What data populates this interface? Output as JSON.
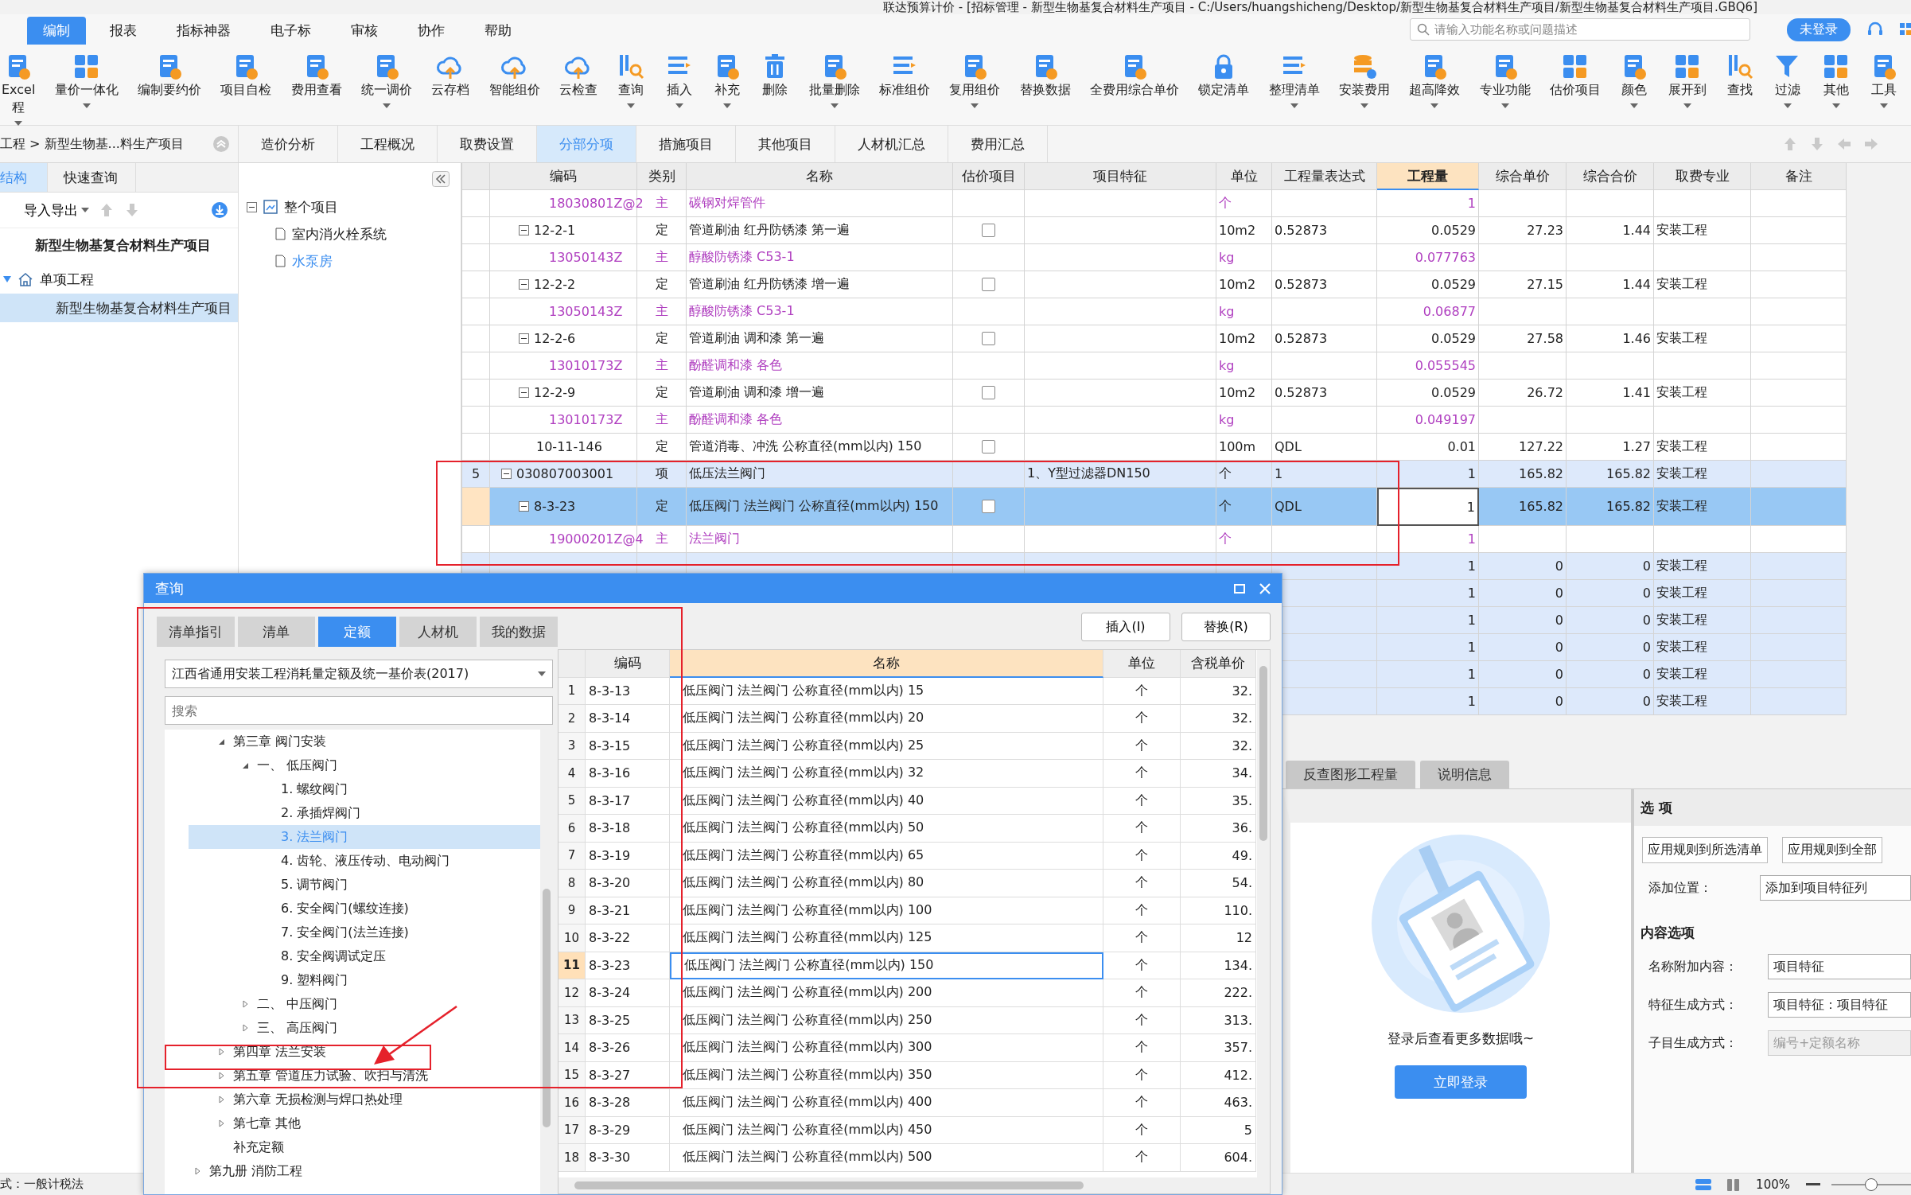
{
  "window": {
    "title": "联达预算计价 - [招标管理 - 新型生物基复合材料生产项目 - C:/Users/huangshicheng/Desktop/新型生物基复合材料生产项目/新型生物基复合材料生产项目.GBQ6]"
  },
  "menu": [
    {
      "label": "编制",
      "selected": true
    },
    {
      "label": "报表",
      "selected": false
    },
    {
      "label": "指标神器",
      "selected": false
    },
    {
      "label": "电子标",
      "selected": false
    },
    {
      "label": "审核",
      "selected": false
    },
    {
      "label": "协作",
      "selected": false
    },
    {
      "label": "帮助",
      "selected": false
    }
  ],
  "search": {
    "placeholder": "请输入功能名称或问题描述"
  },
  "login_status": "未登录",
  "toolbar": [
    {
      "label": "Excel\n程",
      "dropdown": true
    },
    {
      "label": "量价一体化",
      "dropdown": true
    },
    {
      "label": "编制要约价",
      "dropdown": false
    },
    {
      "label": "项目自检",
      "dropdown": false
    },
    {
      "label": "费用查看",
      "dropdown": false
    },
    {
      "label": "统一调价",
      "dropdown": true
    },
    {
      "label": "云存档",
      "dropdown": false
    },
    {
      "label": "智能组价",
      "dropdown": false
    },
    {
      "label": "云检查",
      "dropdown": false
    },
    {
      "label": "查询",
      "dropdown": true
    },
    {
      "label": "插入",
      "dropdown": true
    },
    {
      "label": "补充",
      "dropdown": true
    },
    {
      "label": "删除",
      "dropdown": false
    },
    {
      "label": "批量删除",
      "dropdown": true
    },
    {
      "label": "标准组价",
      "dropdown": false
    },
    {
      "label": "复用组价",
      "dropdown": true
    },
    {
      "label": "替换数据",
      "dropdown": false
    },
    {
      "label": "全费用综合单价",
      "dropdown": false
    },
    {
      "label": "锁定清单",
      "dropdown": false
    },
    {
      "label": "整理清单",
      "dropdown": true
    },
    {
      "label": "安装费用",
      "dropdown": true
    },
    {
      "label": "超高降效",
      "dropdown": true
    },
    {
      "label": "专业功能",
      "dropdown": true
    },
    {
      "label": "估价项目",
      "dropdown": false
    },
    {
      "label": "颜色",
      "dropdown": true
    },
    {
      "label": "展开到",
      "dropdown": true
    },
    {
      "label": "查找",
      "dropdown": false
    },
    {
      "label": "过滤",
      "dropdown": true
    },
    {
      "label": "其他",
      "dropdown": true
    },
    {
      "label": "工具",
      "dropdown": true
    }
  ],
  "breadcrumb": "工程 > 新型生物基...料生产项目",
  "tabs": [
    {
      "label": "造价分析",
      "selected": false
    },
    {
      "label": "工程概况",
      "selected": false
    },
    {
      "label": "取费设置",
      "selected": false
    },
    {
      "label": "分部分项",
      "selected": true
    },
    {
      "label": "措施项目",
      "selected": false
    },
    {
      "label": "其他项目",
      "selected": false
    },
    {
      "label": "人材机汇总",
      "selected": false
    },
    {
      "label": "费用汇总",
      "selected": false
    }
  ],
  "left_panel": {
    "tabs": [
      {
        "label": "结构",
        "selected": true
      },
      {
        "label": "快速查询",
        "selected": false
      }
    ],
    "import_export": "导入导出",
    "tree": [
      {
        "label": "新型生物基复合材料生产项目",
        "selected": false,
        "children": [
          {
            "label": "单项工程",
            "selected": false,
            "expanded": true,
            "children": [
              {
                "label": "新型生物基复合材料生产项目",
                "selected": true
              }
            ]
          }
        ]
      }
    ]
  },
  "unit_tree": [
    {
      "label": "整个项目",
      "expanded": true,
      "selected": false,
      "children": [
        {
          "label": "室内消火栓系统",
          "selected": false
        },
        {
          "label": "水泵房",
          "selected": true
        }
      ]
    }
  ],
  "table": {
    "columns": [
      {
        "label": "编码",
        "selected": false
      },
      {
        "label": "类别",
        "selected": false
      },
      {
        "label": "名称",
        "selected": false
      },
      {
        "label": "估价项目",
        "selected": false
      },
      {
        "label": "项目特征",
        "selected": false
      },
      {
        "label": "单位",
        "selected": false
      },
      {
        "label": "工程量表达式",
        "selected": false
      },
      {
        "label": "工程量",
        "selected": true
      },
      {
        "label": "综合单价",
        "selected": false
      },
      {
        "label": "综合合价",
        "selected": false
      },
      {
        "label": "取费专业",
        "selected": false
      },
      {
        "label": "备注",
        "selected": false
      }
    ],
    "rows": [
      {
        "kind": "main",
        "code": "18030801Z@2",
        "type": "主",
        "name": "碳钢对焊管件",
        "unit": "个",
        "quantity": "1",
        "selected": false
      },
      {
        "kind": "quota",
        "code": "12-2-1",
        "type": "定",
        "name": "管道刷油 红丹防锈漆 第一遍",
        "checked": false,
        "unit": "10m2",
        "expression": "0.52873",
        "quantity": "0.0529",
        "unit_price": "27.23",
        "total": "1.44",
        "fee_type": "安装工程",
        "expanded": true,
        "selected": false,
        "children": [
          {
            "kind": "main",
            "code": "13050143Z",
            "type": "主",
            "name": "醇酸防锈漆 C53-1",
            "unit": "kg",
            "quantity": "0.077763",
            "selected": false
          }
        ]
      },
      {
        "kind": "quota",
        "code": "12-2-2",
        "type": "定",
        "name": "管道刷油 红丹防锈漆 增一遍",
        "checked": false,
        "unit": "10m2",
        "expression": "0.52873",
        "quantity": "0.0529",
        "unit_price": "27.15",
        "total": "1.44",
        "fee_type": "安装工程",
        "expanded": true,
        "selected": false,
        "children": [
          {
            "kind": "main",
            "code": "13050143Z",
            "type": "主",
            "name": "醇酸防锈漆 C53-1",
            "unit": "kg",
            "quantity": "0.06877",
            "selected": false
          }
        ]
      },
      {
        "kind": "quota",
        "code": "12-2-6",
        "type": "定",
        "name": "管道刷油 调和漆 第一遍",
        "checked": false,
        "unit": "10m2",
        "expression": "0.52873",
        "quantity": "0.0529",
        "unit_price": "27.58",
        "total": "1.46",
        "fee_type": "安装工程",
        "expanded": true,
        "selected": false,
        "children": [
          {
            "kind": "main",
            "code": "13010173Z",
            "type": "主",
            "name": "酚醛调和漆 各色",
            "unit": "kg",
            "quantity": "0.055545",
            "selected": false
          }
        ]
      },
      {
        "kind": "quota",
        "code": "12-2-9",
        "type": "定",
        "name": "管道刷油 调和漆 增一遍",
        "checked": false,
        "unit": "10m2",
        "expression": "0.52873",
        "quantity": "0.0529",
        "unit_price": "26.72",
        "total": "1.41",
        "fee_type": "安装工程",
        "expanded": true,
        "selected": false,
        "children": [
          {
            "kind": "main",
            "code": "13010173Z",
            "type": "主",
            "name": "酚醛调和漆 各色",
            "unit": "kg",
            "quantity": "0.049197",
            "selected": false
          }
        ]
      },
      {
        "kind": "quota",
        "code": "10-11-146",
        "type": "定",
        "name": "管道消毒、冲洗 公称直径(mm以内) 150",
        "checked": false,
        "unit": "100m",
        "expression": "QDL",
        "quantity": "0.01",
        "unit_price": "127.22",
        "total": "1.27",
        "fee_type": "安装工程",
        "selected": false
      },
      {
        "kind": "item",
        "no": "5",
        "code": "030807003001",
        "type": "项",
        "name": "低压法兰阀门",
        "feature": "1、Y型过滤器DN150",
        "unit": "个",
        "expression": "1",
        "quantity": "1",
        "unit_price": "165.82",
        "total": "165.82",
        "fee_type": "安装工程",
        "expanded": true,
        "selected": false,
        "children": [
          {
            "kind": "quota",
            "code": "8-3-23",
            "type": "定",
            "name": "低压阀门 法兰阀门 公称直径(mm以内) 150",
            "checked": false,
            "unit": "个",
            "expression": "QDL",
            "quantity": "1",
            "unit_price": "165.82",
            "total": "165.82",
            "fee_type": "安装工程",
            "expanded": true,
            "selected": true,
            "children": [
              {
                "kind": "main",
                "code": "19000201Z@4",
                "type": "主",
                "name": "法兰阀门",
                "unit": "个",
                "quantity": "1",
                "selected": false
              }
            ]
          }
        ]
      },
      {
        "kind": "item",
        "quantity": "1",
        "unit_price": "0",
        "total": "0",
        "fee_type": "安装工程",
        "selected": false
      },
      {
        "kind": "item",
        "quantity": "1",
        "unit_price": "0",
        "total": "0",
        "fee_type": "安装工程",
        "selected": false
      },
      {
        "kind": "item",
        "quantity": "1",
        "unit_price": "0",
        "total": "0",
        "fee_type": "安装工程",
        "selected": false
      },
      {
        "kind": "item",
        "quantity": "1",
        "unit_price": "0",
        "total": "0",
        "fee_type": "安装工程",
        "selected": false
      },
      {
        "kind": "item",
        "quantity": "1",
        "unit_price": "0",
        "total": "0",
        "fee_type": "安装工程",
        "selected": false
      },
      {
        "kind": "item",
        "quantity": "1",
        "unit_price": "0",
        "total": "0",
        "fee_type": "安装工程",
        "selected": false
      }
    ]
  },
  "query_dialog": {
    "title": "查询",
    "tabs": [
      {
        "label": "清单指引",
        "selected": false
      },
      {
        "label": "清单",
        "selected": false
      },
      {
        "label": "定额",
        "selected": true
      },
      {
        "label": "人材机",
        "selected": false
      },
      {
        "label": "我的数据",
        "selected": false
      }
    ],
    "buttons": [
      "插入(I)",
      "替换(R)"
    ],
    "library": "江西省通用安装工程消耗量定额及统一基价表(2017)",
    "search": {
      "placeholder": "搜索"
    },
    "tree": [
      {
        "label": "第三章 阀门安装",
        "expanded": true,
        "selected": false,
        "children": [
          {
            "label": "一、 低压阀门",
            "expanded": true,
            "selected": false,
            "children": [
              {
                "label": "1. 螺纹阀门",
                "selected": false
              },
              {
                "label": "2. 承插焊阀门",
                "selected": false
              },
              {
                "label": "3. 法兰阀门",
                "selected": true
              },
              {
                "label": "4. 齿轮、液压传动、电动阀门",
                "selected": false
              },
              {
                "label": "5. 调节阀门",
                "selected": false
              },
              {
                "label": "6. 安全阀门(螺纹连接)",
                "selected": false
              },
              {
                "label": "7. 安全阀门(法兰连接)",
                "selected": false
              },
              {
                "label": "8. 安全阀调试定压",
                "selected": false
              },
              {
                "label": "9. 塑料阀门",
                "selected": false
              }
            ]
          },
          {
            "label": "二、 中压阀门",
            "expanded": false,
            "selected": false
          },
          {
            "label": "三、 高压阀门",
            "expanded": false,
            "selected": false
          }
        ]
      },
      {
        "label": "第四章 法兰安装",
        "expanded": false,
        "selected": false
      },
      {
        "label": "第五章 管道压力试验、吹扫与清洗",
        "expanded": false,
        "selected": false
      },
      {
        "label": "第六章 无损检测与焊口热处理",
        "expanded": false,
        "selected": false
      },
      {
        "label": "第七章 其他",
        "expanded": false,
        "selected": false
      },
      {
        "label": "补充定额",
        "selected": false
      }
    ],
    "tree_after": [
      {
        "label": "第九册 消防工程",
        "expanded": false,
        "selected": false
      }
    ],
    "columns": [
      {
        "label": "编码",
        "selected": false
      },
      {
        "label": "名称",
        "selected": true
      },
      {
        "label": "单位",
        "selected": false
      },
      {
        "label": "含税单价",
        "selected": false
      }
    ],
    "rows": [
      {
        "no": "1",
        "code": "8-3-13",
        "name": "低压阀门 法兰阀门 公称直径(mm以内) 15",
        "unit": "个",
        "price": "32.",
        "selected": false
      },
      {
        "no": "2",
        "code": "8-3-14",
        "name": "低压阀门 法兰阀门 公称直径(mm以内) 20",
        "unit": "个",
        "price": "32.",
        "selected": false
      },
      {
        "no": "3",
        "code": "8-3-15",
        "name": "低压阀门 法兰阀门 公称直径(mm以内) 25",
        "unit": "个",
        "price": "32.",
        "selected": false
      },
      {
        "no": "4",
        "code": "8-3-16",
        "name": "低压阀门 法兰阀门 公称直径(mm以内) 32",
        "unit": "个",
        "price": "34.",
        "selected": false
      },
      {
        "no": "5",
        "code": "8-3-17",
        "name": "低压阀门 法兰阀门 公称直径(mm以内) 40",
        "unit": "个",
        "price": "35.",
        "selected": false
      },
      {
        "no": "6",
        "code": "8-3-18",
        "name": "低压阀门 法兰阀门 公称直径(mm以内) 50",
        "unit": "个",
        "price": "36.",
        "selected": false
      },
      {
        "no": "7",
        "code": "8-3-19",
        "name": "低压阀门 法兰阀门 公称直径(mm以内) 65",
        "unit": "个",
        "price": "49.",
        "selected": false
      },
      {
        "no": "8",
        "code": "8-3-20",
        "name": "低压阀门 法兰阀门 公称直径(mm以内) 80",
        "unit": "个",
        "price": "54.",
        "selected": false
      },
      {
        "no": "9",
        "code": "8-3-21",
        "name": "低压阀门 法兰阀门 公称直径(mm以内) 100",
        "unit": "个",
        "price": "110.",
        "selected": false
      },
      {
        "no": "10",
        "code": "8-3-22",
        "name": "低压阀门 法兰阀门 公称直径(mm以内) 125",
        "unit": "个",
        "price": "12",
        "selected": false
      },
      {
        "no": "11",
        "code": "8-3-23",
        "name": "低压阀门 法兰阀门 公称直径(mm以内) 150",
        "unit": "个",
        "price": "134.",
        "selected": true
      },
      {
        "no": "12",
        "code": "8-3-24",
        "name": "低压阀门 法兰阀门 公称直径(mm以内) 200",
        "unit": "个",
        "price": "222.",
        "selected": false
      },
      {
        "no": "13",
        "code": "8-3-25",
        "name": "低压阀门 法兰阀门 公称直径(mm以内) 250",
        "unit": "个",
        "price": "313.",
        "selected": false
      },
      {
        "no": "14",
        "code": "8-3-26",
        "name": "低压阀门 法兰阀门 公称直径(mm以内) 300",
        "unit": "个",
        "price": "357.",
        "selected": false
      },
      {
        "no": "15",
        "code": "8-3-27",
        "name": "低压阀门 法兰阀门 公称直径(mm以内) 350",
        "unit": "个",
        "price": "412.",
        "selected": false
      },
      {
        "no": "16",
        "code": "8-3-28",
        "name": "低压阀门 法兰阀门 公称直径(mm以内) 400",
        "unit": "个",
        "price": "463.",
        "selected": false
      },
      {
        "no": "17",
        "code": "8-3-29",
        "name": "低压阀门 法兰阀门 公称直径(mm以内) 450",
        "unit": "个",
        "price": "5",
        "selected": false
      },
      {
        "no": "18",
        "code": "8-3-30",
        "name": "低压阀门 法兰阀门 公称直径(mm以内) 500",
        "unit": "个",
        "price": "604.",
        "selected": false
      }
    ]
  },
  "bottom_panel": {
    "tabs": [
      "反查图形工程量",
      "说明信息"
    ],
    "login_prompt": "登录后查看更多数据哦~",
    "login_button": "立即登录",
    "options": {
      "title": "选 项",
      "buttons": [
        "应用规则到所选清单",
        "应用规则到全部"
      ],
      "fields": [
        {
          "label": "添加位置：",
          "value": "添加到项目特征列",
          "disabled": false
        }
      ],
      "section": "内容选项",
      "content_fields": [
        {
          "label": "名称附加内容：",
          "value": "项目特征",
          "disabled": false
        },
        {
          "label": "特征生成方式：",
          "value": "项目特征：项目特征",
          "disabled": false
        },
        {
          "label": "子目生成方式：",
          "value": "编号+定额名称",
          "disabled": true
        }
      ]
    }
  },
  "status_bar": {
    "tax_method": "式：一般计税法",
    "zoom": "100%",
    "level": 0.5
  },
  "annotations": [
    {
      "kind": "box"
    },
    {
      "kind": "box"
    },
    {
      "kind": "box"
    },
    {
      "kind": "arrow"
    }
  ]
}
